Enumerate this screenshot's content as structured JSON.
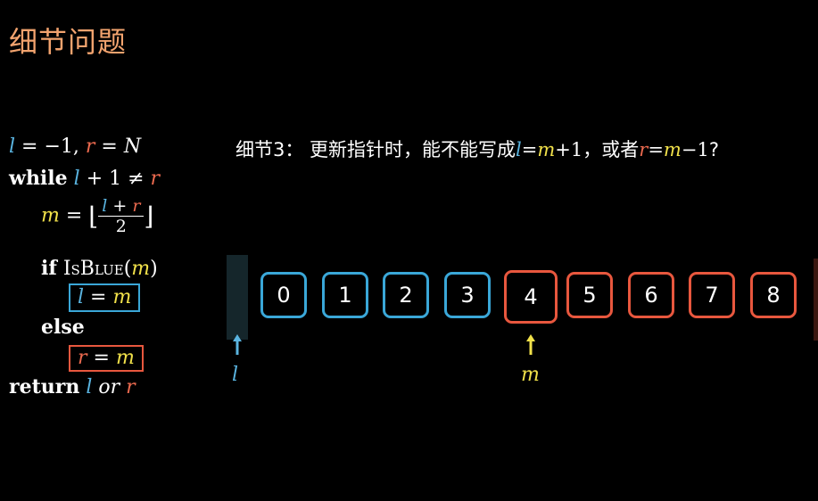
{
  "title": "细节问题",
  "algorithm": {
    "init_l": "l",
    "init_eq1": " = −1,  ",
    "init_r": "r",
    "init_eq2": " = N",
    "while_kw": "while",
    "while_l": "l",
    "while_rest": " + 1 ≠ ",
    "while_r": "r",
    "m_var": "m",
    "m_eq": " = ",
    "m_frac_l": "l",
    "m_frac_plus": " + ",
    "m_frac_r": "r",
    "m_frac_den": "2",
    "if_kw": "if",
    "if_func": "IsBlue",
    "if_arg": "m",
    "assign_l_l": "l",
    "assign_l_eq": " = ",
    "assign_l_m": "m",
    "else_kw": "else",
    "assign_r_r": "r",
    "assign_r_eq": " = ",
    "assign_r_m": "m",
    "return_kw": "return",
    "return_l": "l",
    "return_or": " or ",
    "return_r": "r"
  },
  "question": {
    "prefix": "细节3：  更新指针时，能不能写成",
    "l": "l",
    "eq1": "=",
    "m1": "m",
    "plus1": "+1",
    "middle": "，或者",
    "r": "r",
    "eq2": "=",
    "m2": "m",
    "minus1": "−1",
    "suffix": "?"
  },
  "array": {
    "cells": [
      {
        "value": "0",
        "color": "blue"
      },
      {
        "value": "1",
        "color": "blue"
      },
      {
        "value": "2",
        "color": "blue"
      },
      {
        "value": "3",
        "color": "blue"
      },
      {
        "value": "4",
        "color": "red",
        "highlight": true
      },
      {
        "value": "5",
        "color": "red"
      },
      {
        "value": "6",
        "color": "red"
      },
      {
        "value": "7",
        "color": "red"
      },
      {
        "value": "8",
        "color": "red"
      }
    ],
    "l_pointer": {
      "label": "l",
      "color": "#5ab4e0"
    },
    "m_pointer": {
      "label": "m",
      "color": "#f1e14a",
      "index": 4
    }
  },
  "colors": {
    "blue": "#3aa7d8",
    "red": "#e8573e",
    "yellow": "#f1e14a",
    "title": "#f2a36e"
  }
}
